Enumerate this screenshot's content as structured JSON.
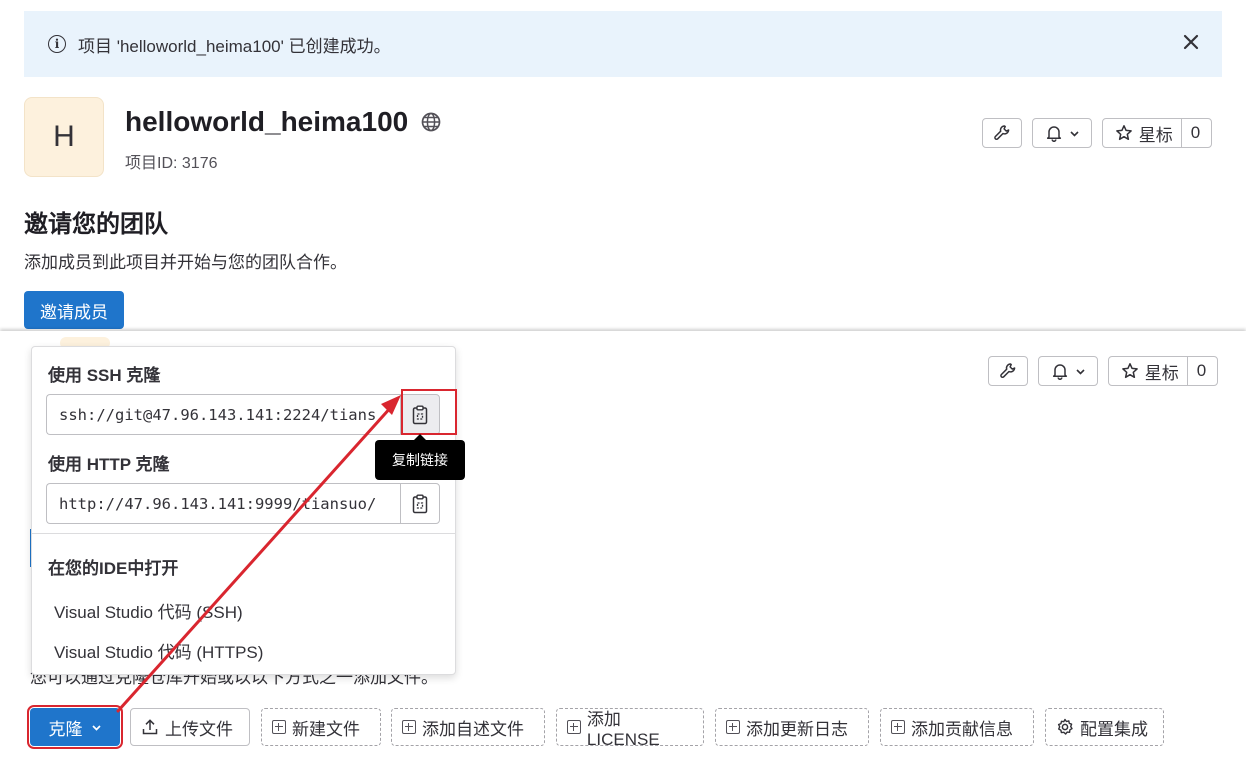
{
  "alert": {
    "message": "项目 'helloworld_heima100' 已创建成功。"
  },
  "project": {
    "avatar_letter": "H",
    "name": "helloworld_heima100",
    "id_label": "项目ID: 3176"
  },
  "header_actions": {
    "star_label": "星标",
    "star_count": "0"
  },
  "invite": {
    "heading": "邀请您的团队",
    "description": "添加成员到此项目并开始与您的团队合作。",
    "button": "邀请成员"
  },
  "clone_dropdown": {
    "ssh_heading": "使用 SSH 克隆",
    "ssh_url": "ssh://git@47.96.143.141:2224/tians",
    "http_heading": "使用 HTTP 克隆",
    "http_url": "http://47.96.143.141:9999/tiansuo/",
    "ide_heading": "在您的IDE中打开",
    "ide_items": [
      "Visual Studio 代码 (SSH)",
      "Visual Studio 代码 (HTTPS)"
    ],
    "tooltip": "复制链接"
  },
  "background_text": "您可以通过克隆仓库开始或以以下方式之一添加文件。",
  "action_bar": {
    "clone": "克隆",
    "upload": "上传文件",
    "new_file": "新建文件",
    "add_readme": "添加自述文件",
    "add_license": "添加LICENSE",
    "add_changelog": "添加更新日志",
    "add_contributing": "添加贡献信息",
    "configure_integrations": "配置集成"
  },
  "colors": {
    "primary": "#1f75cb",
    "alert_bg": "#e9f3fc",
    "annotation": "#d9262f",
    "avatar_bg": "#fdf1dd"
  }
}
